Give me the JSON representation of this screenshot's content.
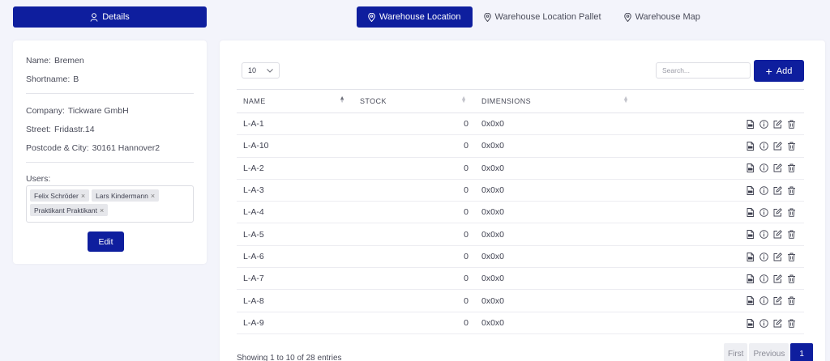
{
  "details_button": {
    "label": "Details",
    "icon": "user-icon"
  },
  "tabs": [
    {
      "label": "Warehouse Location",
      "active": true,
      "icon": "location-pin-icon"
    },
    {
      "label": "Warehouse Location Pallet",
      "active": false,
      "icon": "location-pin-icon"
    },
    {
      "label": "Warehouse Map",
      "active": false,
      "icon": "location-pin-icon"
    }
  ],
  "warehouse": {
    "name_label": "Name:",
    "name": "Bremen",
    "shortname_label": "Shortname:",
    "shortname": "B",
    "company_label": "Company:",
    "company": "Tickware GmbH",
    "street_label": "Street:",
    "street": "Fridastr.14",
    "postcode_label": "Postcode & City:",
    "postcode_city": "30161 Hannover2",
    "users_label": "Users:",
    "users": [
      "Felix Schröder",
      "Lars Kindermann",
      "Praktikant Praktikant"
    ],
    "remove_symbol": "×",
    "edit_label": "Edit"
  },
  "table_controls": {
    "page_size": "10",
    "search_placeholder": "Search...",
    "add_label": "Add"
  },
  "table": {
    "columns": [
      "NAME",
      "STOCK",
      "DIMENSIONS"
    ],
    "rows": [
      {
        "name": "L-A-1",
        "stock": "0",
        "dimensions": "0x0x0"
      },
      {
        "name": "L-A-10",
        "stock": "0",
        "dimensions": "0x0x0"
      },
      {
        "name": "L-A-2",
        "stock": "0",
        "dimensions": "0x0x0"
      },
      {
        "name": "L-A-3",
        "stock": "0",
        "dimensions": "0x0x0"
      },
      {
        "name": "L-A-4",
        "stock": "0",
        "dimensions": "0x0x0"
      },
      {
        "name": "L-A-5",
        "stock": "0",
        "dimensions": "0x0x0"
      },
      {
        "name": "L-A-6",
        "stock": "0",
        "dimensions": "0x0x0"
      },
      {
        "name": "L-A-7",
        "stock": "0",
        "dimensions": "0x0x0"
      },
      {
        "name": "L-A-8",
        "stock": "0",
        "dimensions": "0x0x0"
      },
      {
        "name": "L-A-9",
        "stock": "0",
        "dimensions": "0x0x0"
      }
    ],
    "row_actions": [
      "pdf-icon",
      "info-icon",
      "edit-icon",
      "trash-icon"
    ]
  },
  "footer": {
    "entries_text": "Showing 1 to 10 of 28 entries",
    "first": "First",
    "previous": "Previous",
    "current_page": "1"
  },
  "colors": {
    "accent": "#0e1e9e",
    "background": "#f3f4fb"
  }
}
